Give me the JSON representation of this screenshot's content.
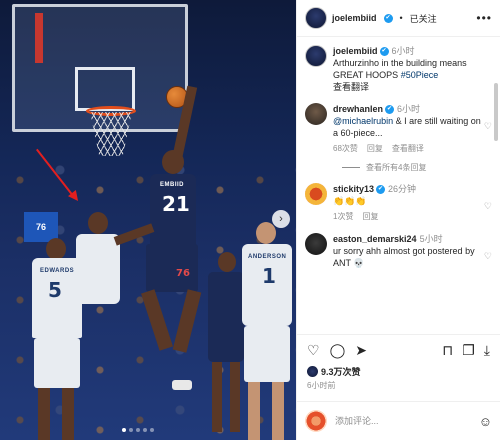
{
  "header": {
    "username": "joelembiid",
    "verified_mark": "✔",
    "follow_state": "已关注",
    "more": "•••"
  },
  "caption": {
    "username": "joelembiid",
    "time": "6小时",
    "text": "Arthurzinho in the building means GREAT HOOPS ",
    "hashtag": "#50Piece",
    "translate": "查看翻译"
  },
  "comments": [
    {
      "username": "drewhanlen",
      "time": "6小时",
      "mention": "@michaelrubin",
      "text": " & I are still waiting on a 60-piece...",
      "likes": "68次赞",
      "reply": "回复",
      "translate": "查看翻译",
      "view_replies": "查看所有4条回复"
    },
    {
      "username": "stickity13",
      "time": "26分钟",
      "text": "👏👏👏",
      "likes": "1次赞",
      "reply": "回复"
    },
    {
      "username": "easton_demarski24",
      "time": "5小时",
      "text": "ur sorry ahh almost got postered by ANT 💀"
    }
  ],
  "actions": {
    "like_icon": "heart-icon",
    "comment_icon": "comment-icon",
    "share_icon": "share-icon",
    "save_icon": "bookmark-icon",
    "copy_icon": "copy-icon",
    "download_icon": "download-icon"
  },
  "likes_count": "9.3万次赞",
  "post_time": "6小时前",
  "add_comment": {
    "placeholder": "添加评论...",
    "emoji_icon": "emoji-icon"
  },
  "photo": {
    "jersey_main_name": "EMBIID",
    "jersey_main_num": "21",
    "jersey_left_name": "EDWARDS",
    "jersey_left_num": "5",
    "jersey_right_name": "ANDERSON",
    "jersey_right_num": "1",
    "shorts_logo": "76",
    "backboard_logo": "76",
    "next_arrow": "›"
  },
  "colors": {
    "verified_blue": "#1d9bf0",
    "link_blue": "#00376b",
    "muted": "#8e8e8e",
    "sixers_navy": "#1b2a56",
    "arrow_red": "#e21f1f"
  }
}
